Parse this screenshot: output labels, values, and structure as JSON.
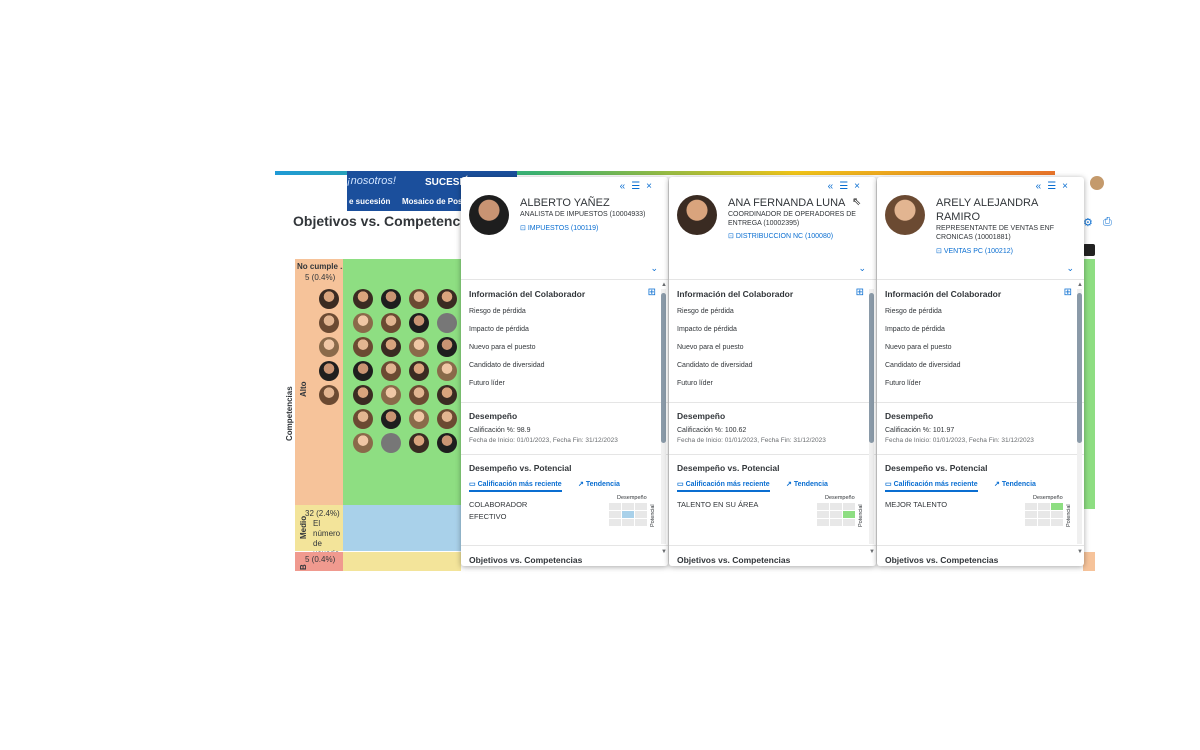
{
  "background": {
    "nav": {
      "banner": "¡nosotros!",
      "title": "SUCESIÓ",
      "tab1": "e sucesión",
      "tab2": "Mosaico de Posic"
    },
    "page_title": "Objetivos vs. Competencias",
    "y_axis_label": "Competencias",
    "rows": {
      "alto_label": "Alto",
      "medio_label": "Medio",
      "bajo_label": "B"
    },
    "columns": {
      "no_cumple_title": "No cumple ...",
      "no_cumple_count": "5 (0.4%)"
    },
    "medio_count": "32 (2.4%)",
    "medio_desc": "El número de usuario",
    "bajo_count": "5 (0.4%)",
    "colors": {
      "green": "#8ede82",
      "blue": "#a9d1ea",
      "yellow": "#f3e49a",
      "peach": "#f6c39a",
      "red": "#f09a8f"
    }
  },
  "cards": [
    {
      "name": "ALBERTO YAÑEZ",
      "role": "ANALISTA DE IMPUESTOS (10004933)",
      "dept": "IMPUESTOS (100119)",
      "info_title": "Información del Colaborador",
      "fields": [
        "Riesgo de pérdida",
        "Impacto de pérdida",
        "Nuevo para el puesto",
        "Candidato de diversidad",
        "Futuro líder"
      ],
      "perf_title": "Desempeño",
      "score": "Calificación %: 98.9",
      "dates": "Fecha de Inicio: 01/01/2023, Fecha Fin: 31/12/2023",
      "dvp_title": "Desempeño vs. Potencial",
      "tab_recent": "Calificación más reciente",
      "tab_trend": "Tendencia",
      "category": "COLABORADOR EFECTIVO",
      "mini_x_label": "Desempeño",
      "mini_y_label": "Potencial",
      "mini_highlight_color": "#a9d1ea",
      "footer_title": "Objetivos vs. Competencias"
    },
    {
      "name": "ANA FERNANDA LUNA",
      "role": "COORDINADOR DE OPERADORES DE ENTREGA (10002395)",
      "dept": "DISTRIBUCCION NC (100080)",
      "info_title": "Información del Colaborador",
      "fields": [
        "Riesgo de pérdida",
        "Impacto de pérdida",
        "Nuevo para el puesto",
        "Candidato de diversidad",
        "Futuro líder"
      ],
      "perf_title": "Desempeño",
      "score": "Calificación %: 100.62",
      "dates": "Fecha de Inicio: 01/01/2023, Fecha Fin: 31/12/2023",
      "dvp_title": "Desempeño vs. Potencial",
      "tab_recent": "Calificación más reciente",
      "tab_trend": "Tendencia",
      "category": "TALENTO EN SU ÁREA",
      "mini_x_label": "Desempeño",
      "mini_y_label": "Potencial",
      "mini_highlight_color": "#8ede82",
      "footer_title": "Objetivos vs. Competencias"
    },
    {
      "name": "ARELY ALEJANDRA RAMIRO",
      "role": "REPRESENTANTE DE VENTAS ENF CRONICAS (10001881)",
      "dept": "VENTAS PC (100212)",
      "info_title": "Información del Colaborador",
      "fields": [
        "Riesgo de pérdida",
        "Impacto de pérdida",
        "Nuevo para el puesto",
        "Candidato de diversidad",
        "Futuro líder"
      ],
      "perf_title": "Desempeño",
      "score": "Calificación %: 101.97",
      "dates": "Fecha de Inicio: 01/01/2023, Fecha Fin: 31/12/2023",
      "dvp_title": "Desempeño vs. Potencial",
      "tab_recent": "Calificación más reciente",
      "tab_trend": "Tendencia",
      "category": "MEJOR TALENTO",
      "mini_x_label": "Desempeño",
      "mini_y_label": "Potencial",
      "mini_highlight_color": "#8ede82",
      "footer_title": "Objetivos vs. Competencias"
    }
  ]
}
